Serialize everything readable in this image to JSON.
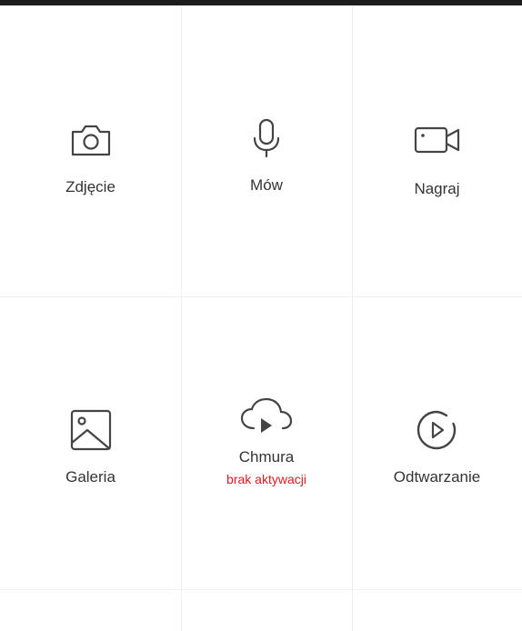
{
  "tiles": {
    "photo": {
      "label": "Zdjęcie",
      "icon": "camera-icon"
    },
    "talk": {
      "label": "Mów",
      "icon": "microphone-icon"
    },
    "record": {
      "label": "Nagraj",
      "icon": "video-camera-icon"
    },
    "gallery": {
      "label": "Galeria",
      "icon": "image-icon"
    },
    "cloud": {
      "label": "Chmura",
      "status": "brak aktywacji",
      "icon": "cloud-play-icon"
    },
    "playback": {
      "label": "Odtwarzanie",
      "icon": "playback-icon"
    }
  },
  "colors": {
    "top_bar": "#1c1c1c",
    "icon_stroke": "#444444",
    "text": "#333333",
    "status_red": "#d81e1e",
    "divider": "#f0f0f0"
  }
}
